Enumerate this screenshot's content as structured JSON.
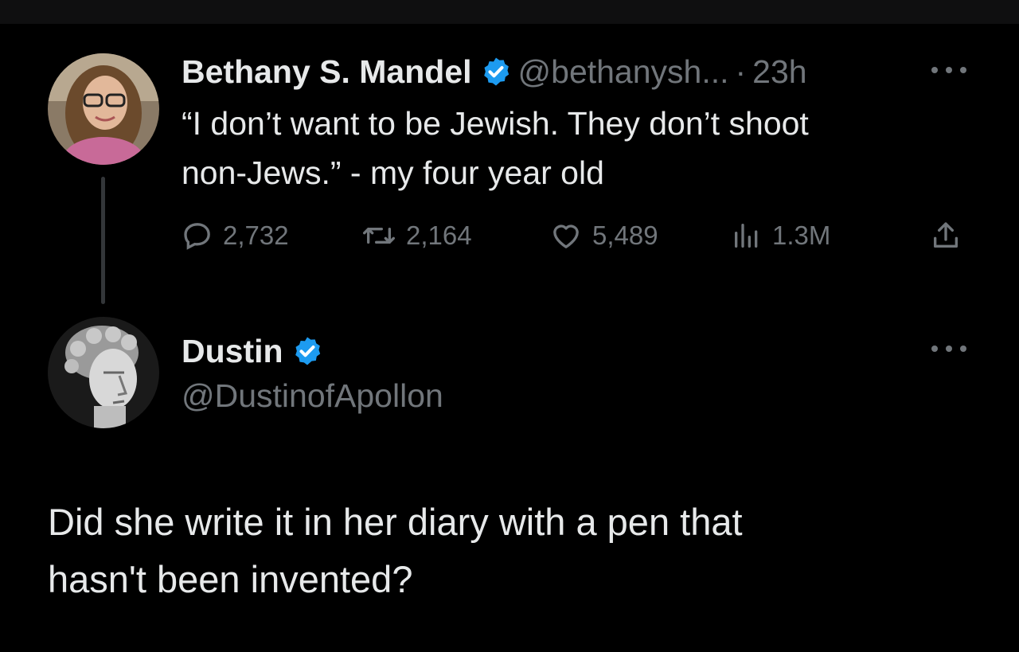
{
  "original_tweet": {
    "author_name": "Bethany S. Mandel",
    "handle": "@bethanysh...",
    "separator": "·",
    "time": "23h",
    "text_line1": "“I don’t want to be Jewish. They don’t shoot",
    "text_line2": "non-Jews.” - my four year old",
    "stats": {
      "replies": "2,732",
      "retweets": "2,164",
      "likes": "5,489",
      "views": "1.3M"
    }
  },
  "reply_tweet": {
    "author_name": "Dustin",
    "handle": "@DustinofApollon",
    "text_line1": "Did she write it in her diary with a pen that",
    "text_line2": "hasn't been invented?"
  },
  "colors": {
    "background": "#000000",
    "text": "#e7e9ea",
    "muted": "#71767b",
    "verified": "#1d9bf0"
  },
  "icons": [
    "verified-badge-icon",
    "more-icon",
    "reply-icon",
    "retweet-icon",
    "like-icon",
    "views-icon",
    "share-icon"
  ]
}
